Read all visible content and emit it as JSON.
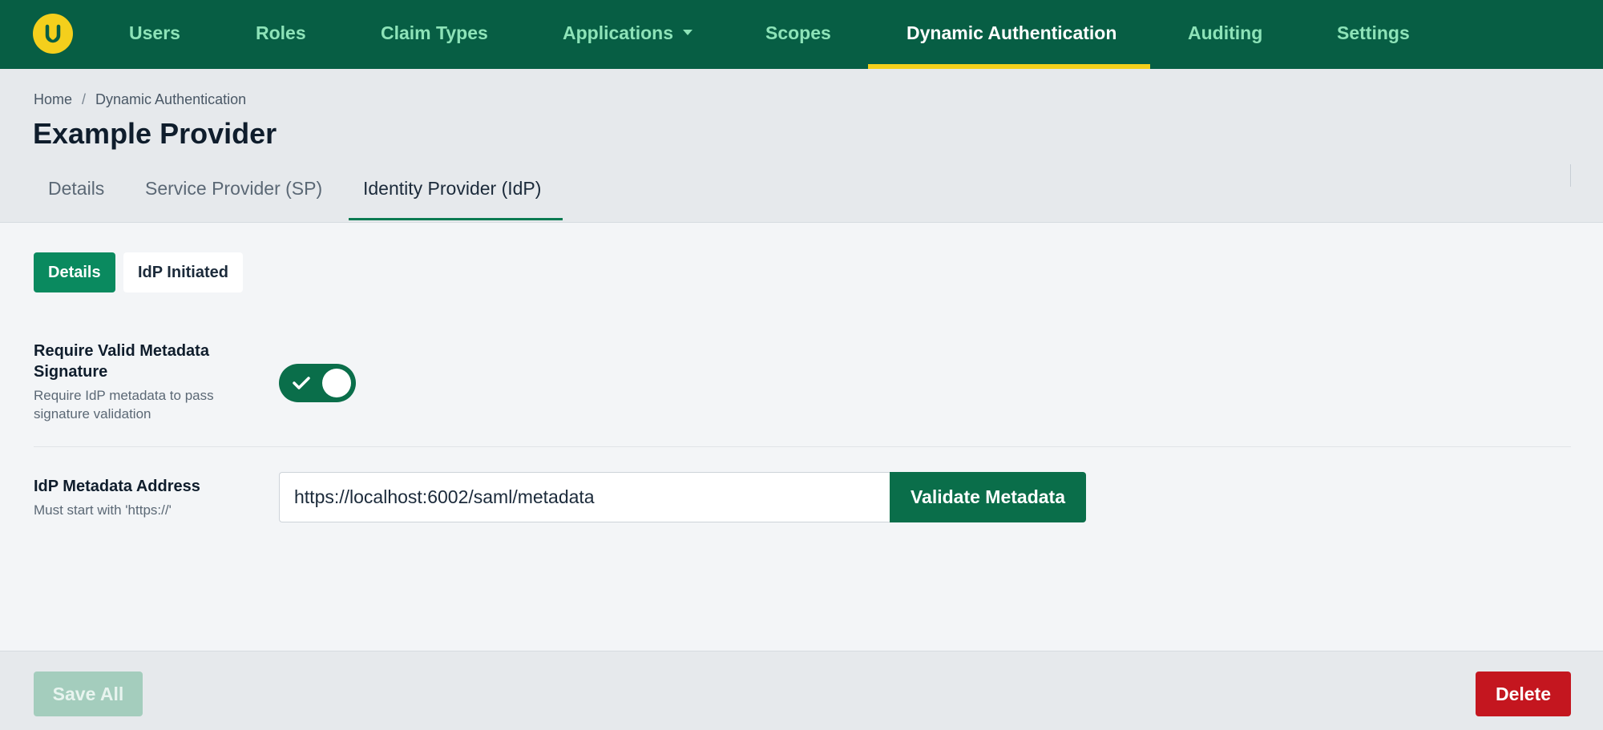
{
  "nav": {
    "logo_icon": "u-logo-icon",
    "items": [
      {
        "label": "Users"
      },
      {
        "label": "Roles"
      },
      {
        "label": "Claim Types"
      },
      {
        "label": "Applications",
        "icon": "chevron-down-icon"
      },
      {
        "label": "Scopes"
      },
      {
        "label": "Dynamic Authentication",
        "active": true
      },
      {
        "label": "Auditing"
      },
      {
        "label": "Settings"
      }
    ]
  },
  "breadcrumb": {
    "home": "Home",
    "separator": "/",
    "current": "Dynamic Authentication"
  },
  "page": {
    "title": "Example Provider"
  },
  "tabs": [
    {
      "label": "Details"
    },
    {
      "label": "Service Provider (SP)"
    },
    {
      "label": "Identity Provider (IdP)",
      "active": true
    }
  ],
  "subtabs": [
    {
      "label": "Details",
      "active": true
    },
    {
      "label": "IdP Initiated"
    }
  ],
  "form": {
    "require_signature": {
      "label": "Require Valid Metadata Signature",
      "help": "Require IdP metadata to pass signature validation",
      "checked": true
    },
    "metadata_address": {
      "label": "IdP Metadata Address",
      "help": "Must start with 'https://'",
      "value": "https://localhost:6002/saml/metadata",
      "button_label": "Validate Metadata"
    }
  },
  "footer": {
    "save_label": "Save All",
    "delete_label": "Delete"
  },
  "colors": {
    "nav_bg": "#075e44",
    "accent": "#f4cf1c",
    "primary": "#0a6e4a",
    "danger": "#c4161f"
  }
}
